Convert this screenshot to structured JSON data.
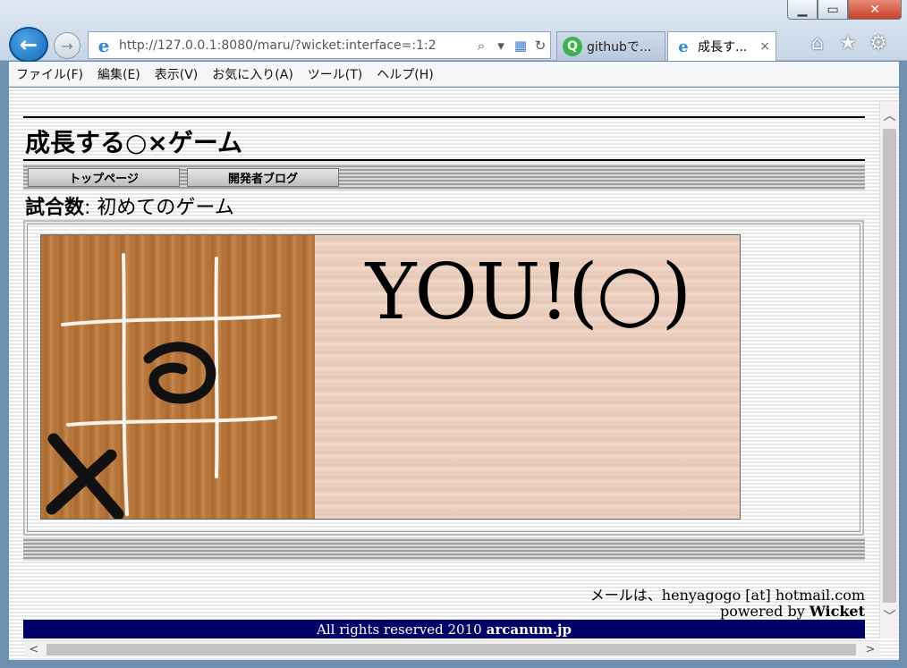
{
  "browser": {
    "url": "http://127.0.0.1:8080/maru/?wicket:interface=:1:2",
    "tabs": [
      {
        "label": "githubで..."
      },
      {
        "label": "成長す..."
      }
    ],
    "tab_close": "×",
    "menu": [
      "ファイル(F)",
      "編集(E)",
      "表示(V)",
      "お気に入り(A)",
      "ツール(T)",
      "ヘルプ(H)"
    ]
  },
  "page": {
    "site_title": "成長する○×ゲーム",
    "nav": [
      "トップページ",
      "開発者ブログ"
    ],
    "games_label": "試合数",
    "games_separator": ": ",
    "games_value": "初めてのゲーム",
    "result_text": "YOU!(○)",
    "mail_text": "メールは、henyagogo [at] hotmail.com",
    "powered_prefix": "powered by",
    "powered_name": "Wicket",
    "footer_prefix": "All rights reserved 2010",
    "footer_site": "arcanum.jp"
  },
  "icons": {
    "back": "back-arrow-icon",
    "forward": "forward-arrow-icon",
    "home": "home-icon",
    "favorites": "star-icon",
    "settings": "gear-icon"
  }
}
